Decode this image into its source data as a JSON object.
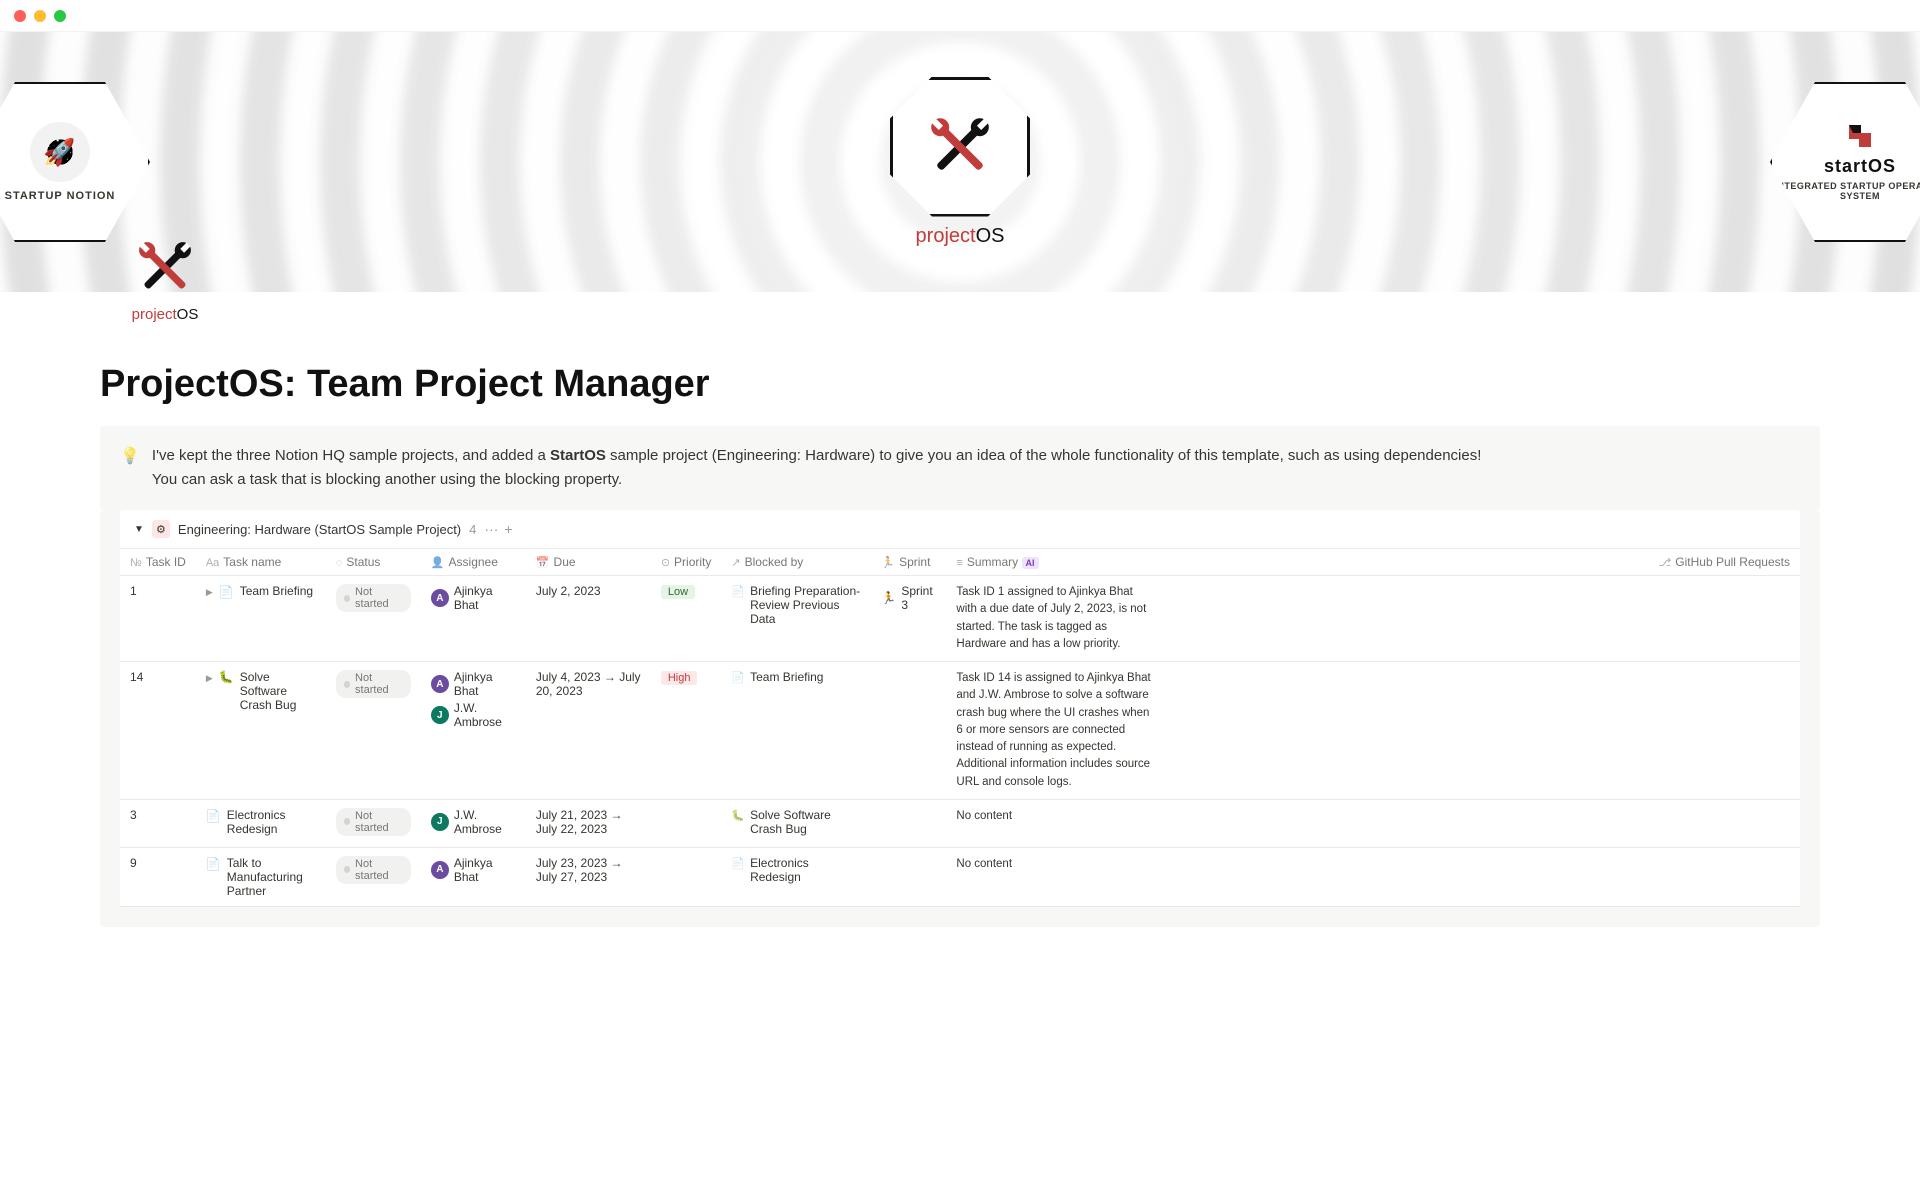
{
  "banner": {
    "left_badge": "STARTUP NOTION",
    "center_brand_1": "project",
    "center_brand_2": "OS",
    "right_brand": "startOS",
    "right_sub": "INTEGRATED STARTUP OPERATING SYSTEM"
  },
  "page_icon_brand_1": "project",
  "page_icon_brand_2": "OS",
  "title": "ProjectOS: Team Project Manager",
  "callout": {
    "line1a": "I've kept the three Notion HQ sample projects, and added a ",
    "line1b": "StartOS",
    "line1c": " sample project (Engineering: Hardware) to give you an idea of the whole functionality of this template, such as using dependencies!",
    "line2": "You can ask a task that is blocking another using the blocking property."
  },
  "group": {
    "name": "Engineering: Hardware (StartOS Sample Project)",
    "count": "4",
    "more": "···",
    "add": "+"
  },
  "columns": {
    "task_id": "Task ID",
    "task_name": "Task name",
    "status": "Status",
    "assignee": "Assignee",
    "due": "Due",
    "priority": "Priority",
    "blocked_by": "Blocked by",
    "sprint": "Sprint",
    "summary": "Summary",
    "ai_badge": "AI",
    "github": "GitHub Pull Requests"
  },
  "rows": [
    {
      "id": "1",
      "name": "Team Briefing",
      "icon": "doc",
      "toggle": true,
      "status": "Not started",
      "assignees": [
        {
          "initial": "A",
          "cls": "av-a",
          "name": "Ajinkya Bhat"
        }
      ],
      "due": "July 2, 2023",
      "priority": "Low",
      "priority_cls": "priority-low",
      "blocked_by": "Briefing Preparation- Review Previous Data",
      "blocked_icon": "doc",
      "sprint": "Sprint 3",
      "summary": "Task ID 1 assigned to Ajinkya Bhat with a due date of July 2, 2023, is not started. The task is tagged as Hardware and has a low priority."
    },
    {
      "id": "14",
      "name": "Solve Software Crash Bug",
      "icon": "bug",
      "toggle": true,
      "status": "Not started",
      "assignees": [
        {
          "initial": "A",
          "cls": "av-a",
          "name": "Ajinkya Bhat"
        },
        {
          "initial": "J",
          "cls": "av-j",
          "name": "J.W. Ambrose"
        }
      ],
      "due": "July 4, 2023 → July 20, 2023",
      "priority": "High",
      "priority_cls": "priority-high",
      "blocked_by": "Team Briefing",
      "blocked_icon": "doc",
      "sprint": "",
      "summary": "Task ID 14 is assigned to Ajinkya Bhat and J.W. Ambrose to solve a software crash bug where the UI crashes when 6 or more sensors are connected instead of running as expected. Additional information includes source URL and console logs."
    },
    {
      "id": "3",
      "name": "Electronics Redesign",
      "icon": "doc",
      "toggle": false,
      "status": "Not started",
      "assignees": [
        {
          "initial": "J",
          "cls": "av-j",
          "name": "J.W. Ambrose"
        }
      ],
      "due": "July 21, 2023 → July 22, 2023",
      "priority": "",
      "priority_cls": "",
      "blocked_by": "Solve Software Crash Bug",
      "blocked_icon": "bug",
      "sprint": "",
      "summary": "No content"
    },
    {
      "id": "9",
      "name": "Talk to Manufacturing Partner",
      "icon": "doc",
      "toggle": false,
      "status": "Not started",
      "assignees": [
        {
          "initial": "A",
          "cls": "av-a",
          "name": "Ajinkya Bhat"
        }
      ],
      "due": "July 23, 2023 → July 27, 2023",
      "priority": "",
      "priority_cls": "",
      "blocked_by": "Electronics Redesign",
      "blocked_icon": "doc",
      "sprint": "",
      "summary": "No content"
    }
  ]
}
